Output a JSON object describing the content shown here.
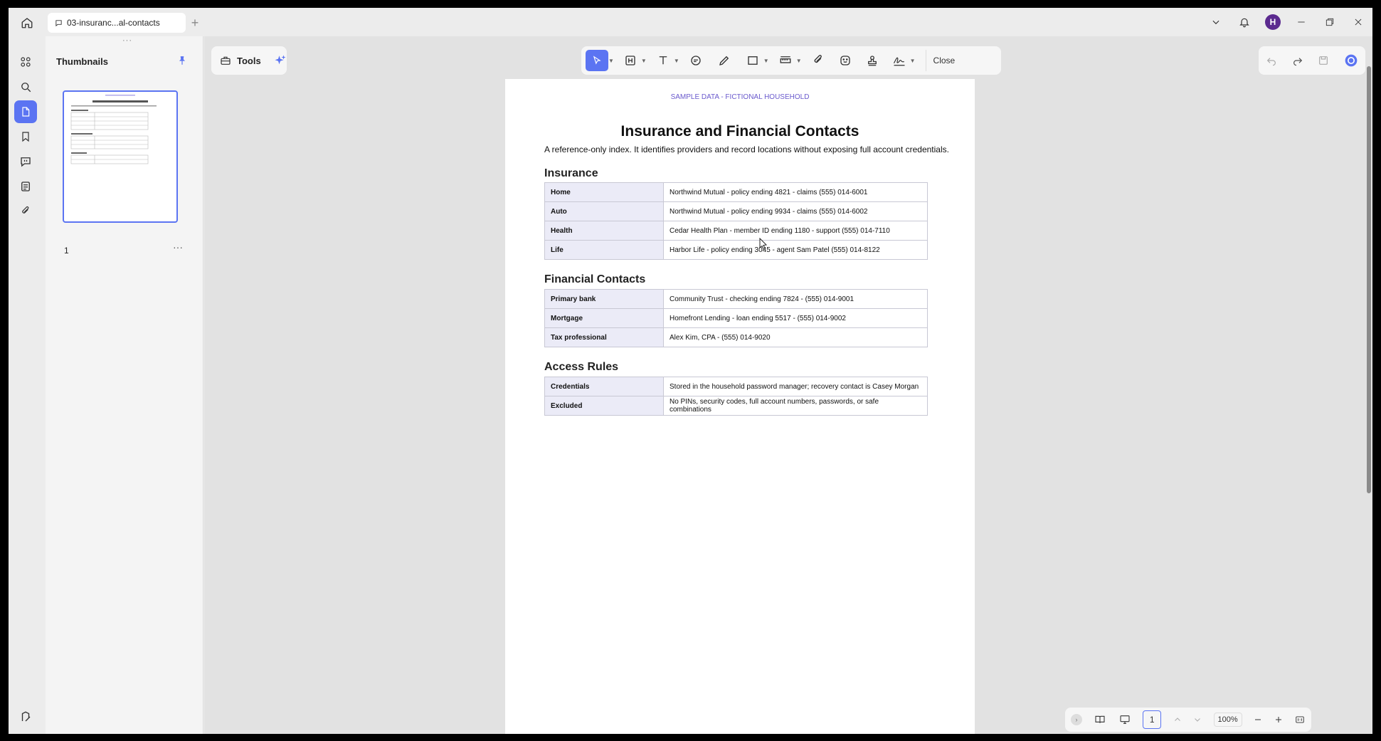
{
  "titlebar": {
    "tab_label": "03-insuranc...al-contacts",
    "new_tab": "+",
    "avatar_initial": "H"
  },
  "thumbnails": {
    "title": "Thumbnails",
    "drag_dots": "···",
    "page_label": "1",
    "more": "···"
  },
  "toolbar": {
    "tools_label": "Tools",
    "close_label": "Close"
  },
  "document": {
    "header_note": "SAMPLE DATA - FICTIONAL HOUSEHOLD",
    "title": "Insurance and Financial Contacts",
    "subtitle": "A reference-only index. It identifies providers and record locations without exposing full account credentials.",
    "sections": [
      {
        "heading": "Insurance",
        "rows": [
          {
            "key": "Home",
            "value": "Northwind Mutual - policy ending 4821 - claims (555) 014-6001"
          },
          {
            "key": "Auto",
            "value": "Northwind Mutual - policy ending 9934 - claims (555) 014-6002"
          },
          {
            "key": "Health",
            "value": "Cedar Health Plan - member ID ending 1180 - support (555) 014-7110"
          },
          {
            "key": "Life",
            "value": "Harbor Life - policy ending 3045 - agent Sam Patel (555) 014-8122"
          }
        ]
      },
      {
        "heading": "Financial Contacts",
        "rows": [
          {
            "key": "Primary bank",
            "value": "Community Trust - checking ending 7824 - (555) 014-9001"
          },
          {
            "key": "Mortgage",
            "value": "Homefront Lending - loan ending 5517 - (555) 014-9002"
          },
          {
            "key": "Tax professional",
            "value": "Alex Kim, CPA - (555) 014-9020"
          }
        ]
      },
      {
        "heading": "Access Rules",
        "rows": [
          {
            "key": "Credentials",
            "value": "Stored in the household password manager; recovery contact is Casey Morgan"
          },
          {
            "key": "Excluded",
            "value": "No PINs, security codes, full account numbers, passwords, or safe combinations"
          }
        ]
      }
    ]
  },
  "statusbar": {
    "page_number": "1",
    "zoom": "100%"
  },
  "colors": {
    "accent": "#5b74f2",
    "avatar": "#5b2a8f",
    "header_note": "#6a5acd",
    "key_cell_bg": "#ebebf7"
  }
}
